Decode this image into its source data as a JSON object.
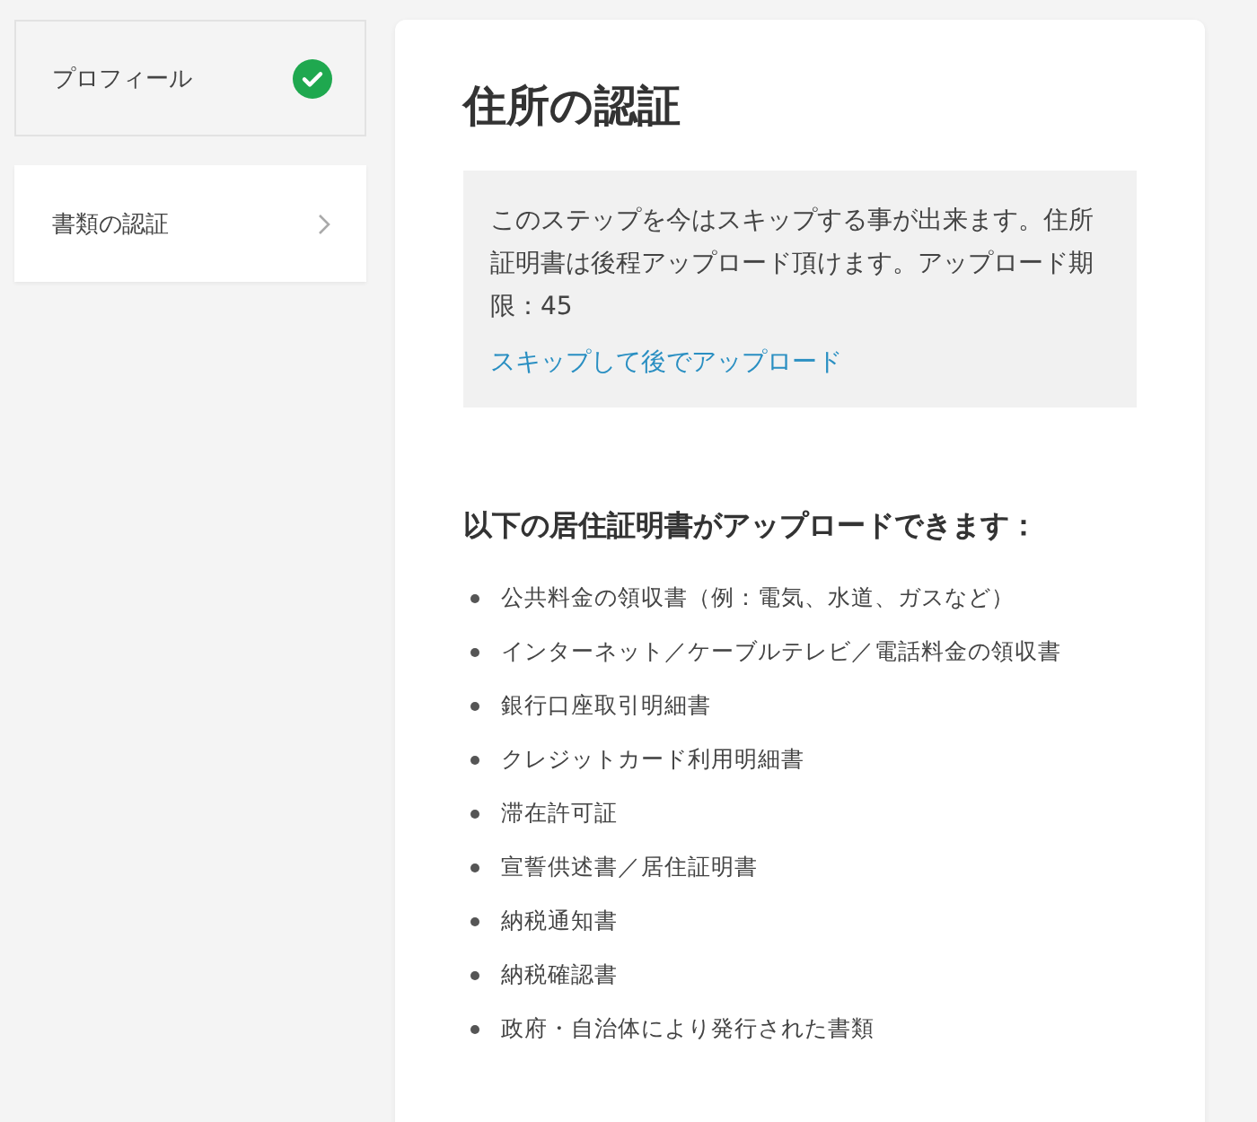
{
  "sidebar": {
    "steps": [
      {
        "label": "プロフィール",
        "completed": true,
        "selected": false
      },
      {
        "label": "書類の認証",
        "completed": false,
        "selected": true
      }
    ]
  },
  "main": {
    "title": "住所の認証",
    "notice": {
      "text": "このステップを今はスキップする事が出来ます。住所証明書は後程アップロード頂けます。アップロード期限：45",
      "link": "スキップして後でアップロード"
    },
    "list_heading": "以下の居住証明書がアップロードできます：",
    "documents": [
      "公共料金の領収書（例：電気、水道、ガスなど）",
      "インターネット／ケーブルテレビ／電話料金の領収書",
      "銀行口座取引明細書",
      "クレジットカード利用明細書",
      "滞在許可証",
      "宣誓供述書／居住証明書",
      "納税通知書",
      "納税確認書",
      "政府・自治体により発行された書類"
    ]
  }
}
